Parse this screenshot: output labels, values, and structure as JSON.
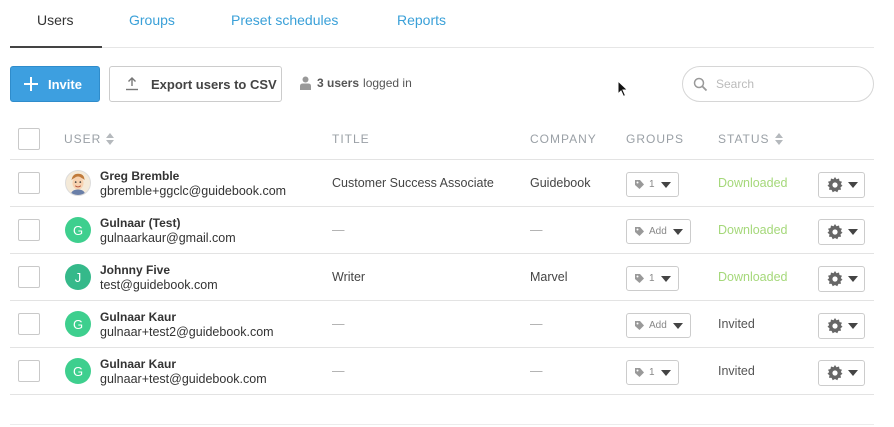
{
  "tabs": [
    {
      "label": "Users",
      "active": true
    },
    {
      "label": "Groups",
      "active": false
    },
    {
      "label": "Preset schedules",
      "active": false
    },
    {
      "label": "Reports",
      "active": false
    }
  ],
  "toolbar": {
    "invite_label": "Invite",
    "export_label": "Export users to CSV",
    "logged_in_count": "3 users",
    "logged_in_suffix": "logged in",
    "search_placeholder": "Search"
  },
  "table": {
    "columns": {
      "user": "USER",
      "title": "TITLE",
      "company": "COMPANY",
      "groups": "GROUPS",
      "status": "STATUS"
    },
    "rows": [
      {
        "initial": "",
        "avatar": "photo",
        "name": "Greg Bremble",
        "email": "gbremble+ggclc@guidebook.com",
        "title": "Customer Success Associate",
        "company": "Guidebook",
        "groups": "1",
        "status": "Downloaded"
      },
      {
        "initial": "G",
        "avatar": "initial",
        "name": "Gulnaar (Test)",
        "email": "gulnaarkaur@gmail.com",
        "title": "—",
        "company": "—",
        "groups": "Add",
        "status": "Downloaded"
      },
      {
        "initial": "J",
        "avatar": "initial",
        "name": "Johnny Five",
        "email": "test@guidebook.com",
        "title": "Writer",
        "company": "Marvel",
        "groups": "1",
        "status": "Downloaded"
      },
      {
        "initial": "G",
        "avatar": "initial",
        "name": "Gulnaar Kaur",
        "email": "gulnaar+test2@guidebook.com",
        "title": "—",
        "company": "—",
        "groups": "Add",
        "status": "Invited"
      },
      {
        "initial": "G",
        "avatar": "initial",
        "name": "Gulnaar Kaur",
        "email": "gulnaar+test@guidebook.com",
        "title": "—",
        "company": "—",
        "groups": "1",
        "status": "Invited"
      }
    ]
  },
  "colors": {
    "accent": "#3d9fe0",
    "tab_link": "#3aa0d8",
    "avatar_green": "#3ecf8e",
    "status_downloaded": "#a5d87a"
  },
  "icons": {
    "invite": "plus-icon",
    "export": "upload-icon",
    "logged_in": "user-icon",
    "search": "search-icon",
    "group": "tag-icon",
    "actions": "gear-icon"
  }
}
